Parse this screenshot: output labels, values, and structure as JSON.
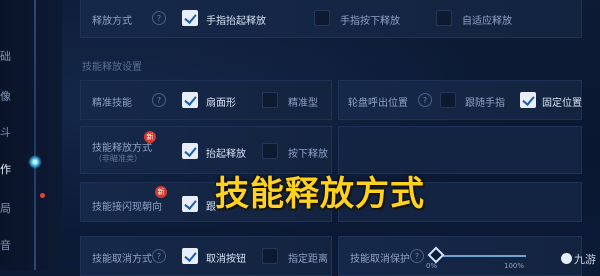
{
  "left_nav": {
    "items": [
      {
        "label": "础"
      },
      {
        "label": "像"
      },
      {
        "label": "斗"
      },
      {
        "label": "作"
      },
      {
        "label": "局"
      },
      {
        "label": "音"
      }
    ]
  },
  "section_title": "技能释放设置",
  "rows": {
    "release_mode": {
      "label": "释放方式",
      "opt1": "手指抬起释放",
      "opt2": "手指按下释放",
      "opt3": "自适应释放"
    },
    "precise_skill": {
      "label": "精准技能",
      "opt1": "扇面形",
      "opt2": "精准型"
    },
    "wheel_position": {
      "label": "轮盘呼出位置",
      "opt1": "跟随手指",
      "opt2": "固定位置"
    },
    "skill_release": {
      "label": "技能释放方式",
      "sublabel": "（非瞄准类）",
      "opt1": "抬起释放",
      "opt2": "按下释放"
    },
    "skill_flash": {
      "label": "技能接闪现朝向",
      "opt1": "跟"
    },
    "skill_cancel": {
      "label": "技能取消方式",
      "opt1": "取消按钮",
      "opt2": "指定距离"
    },
    "cancel_protect": {
      "label": "技能取消保护",
      "min_label": "0%",
      "max_label": "100%"
    }
  },
  "badge_new": "新",
  "overlay_title": "技能释放方式",
  "watermark": "九游",
  "colors": {
    "background": "#0c1a33",
    "panel": "#16284a",
    "checkbox_checked": "#e8eef9",
    "overlay": "#ffd21f",
    "badge": "#d63a2f"
  }
}
